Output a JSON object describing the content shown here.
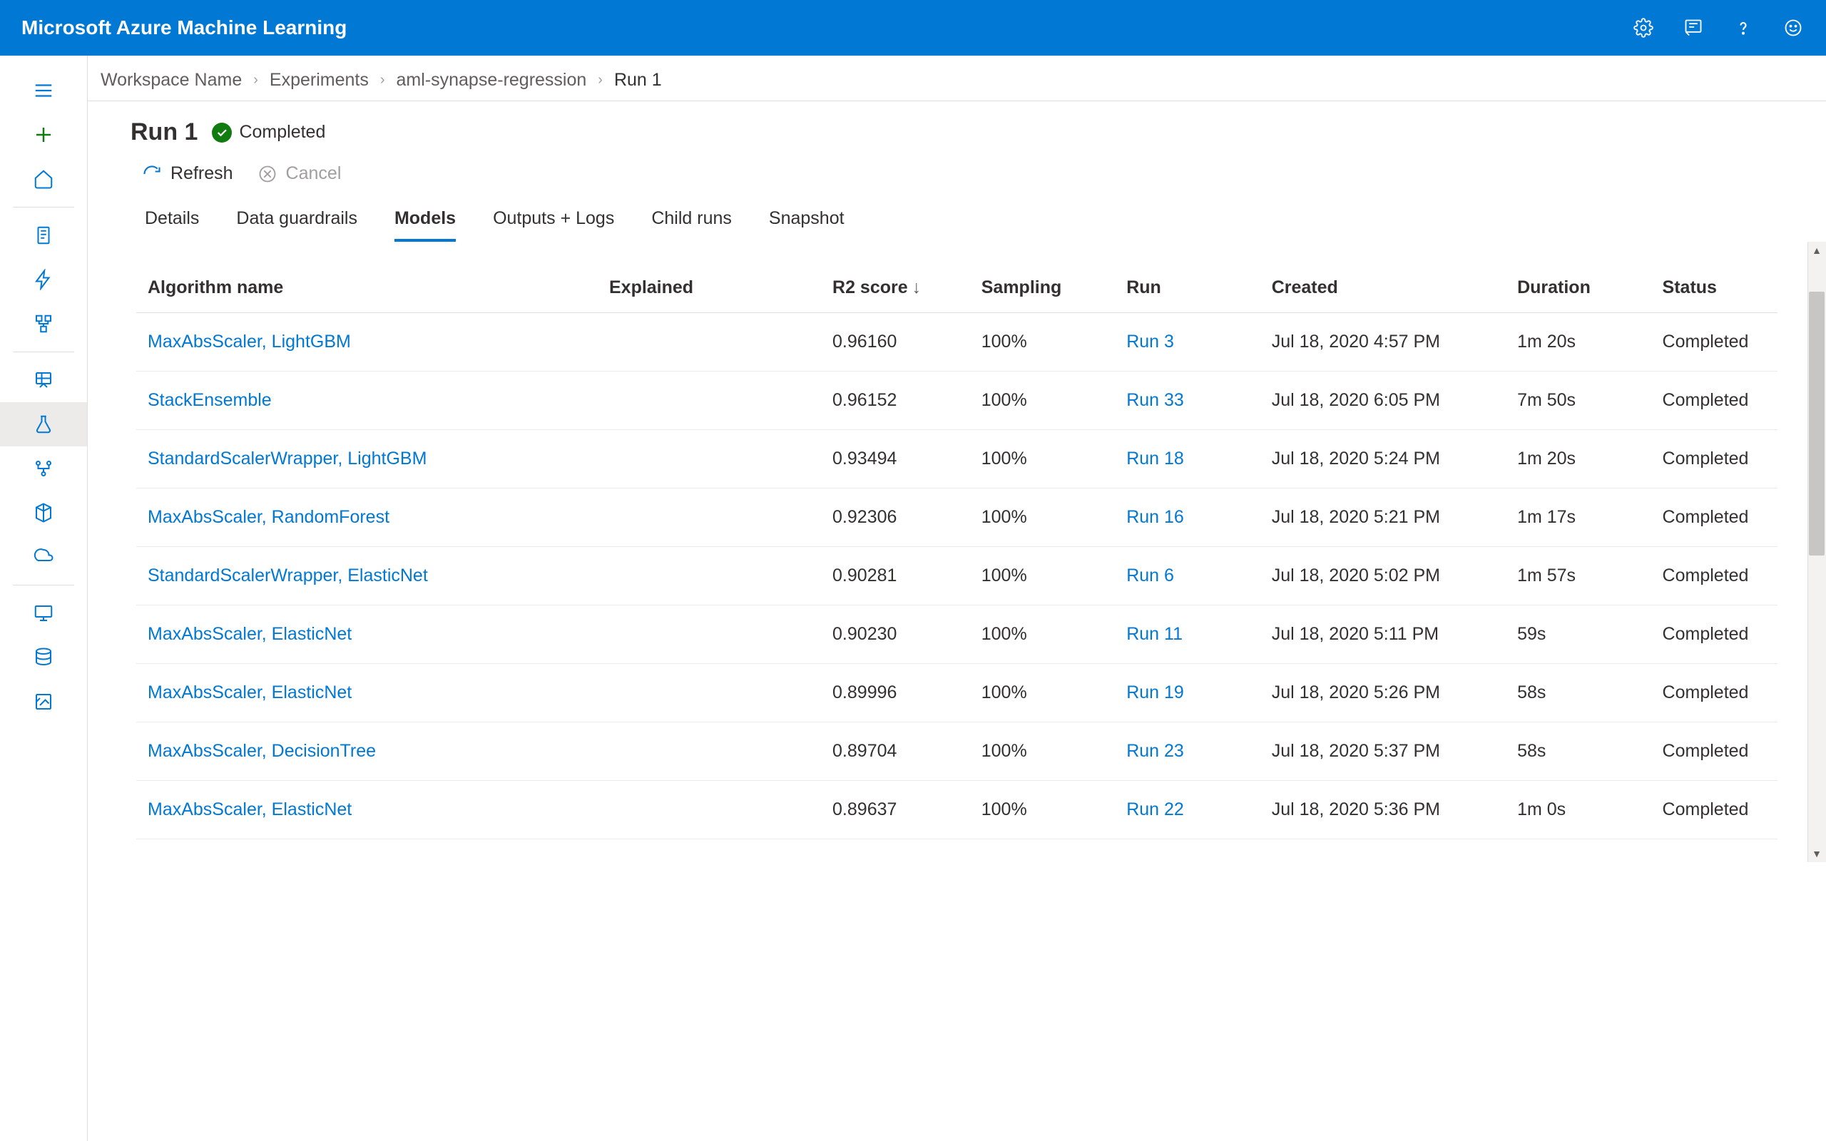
{
  "app_title": "Microsoft Azure Machine Learning",
  "breadcrumb": {
    "workspace": "Workspace Name",
    "experiments": "Experiments",
    "experiment_name": "aml-synapse-regression",
    "current": "Run 1"
  },
  "run": {
    "title": "Run 1",
    "status": "Completed"
  },
  "toolbar": {
    "refresh": "Refresh",
    "cancel": "Cancel"
  },
  "tabs": {
    "details": "Details",
    "data_guardrails": "Data guardrails",
    "models": "Models",
    "outputs_logs": "Outputs + Logs",
    "child_runs": "Child runs",
    "snapshot": "Snapshot"
  },
  "columns": {
    "algorithm": "Algorithm name",
    "explained": "Explained",
    "r2": "R2 score",
    "sampling": "Sampling",
    "run": "Run",
    "created": "Created",
    "duration": "Duration",
    "status": "Status"
  },
  "rows": [
    {
      "algorithm": "MaxAbsScaler, LightGBM",
      "explained": "",
      "r2": "0.96160",
      "sampling": "100%",
      "run": "Run 3",
      "created": "Jul 18, 2020 4:57 PM",
      "duration": "1m 20s",
      "status": "Completed"
    },
    {
      "algorithm": "StackEnsemble",
      "explained": "",
      "r2": "0.96152",
      "sampling": "100%",
      "run": "Run 33",
      "created": "Jul 18, 2020 6:05 PM",
      "duration": "7m 50s",
      "status": "Completed"
    },
    {
      "algorithm": "StandardScalerWrapper, LightGBM",
      "explained": "",
      "r2": "0.93494",
      "sampling": "100%",
      "run": "Run 18",
      "created": "Jul 18, 2020 5:24 PM",
      "duration": "1m 20s",
      "status": "Completed"
    },
    {
      "algorithm": "MaxAbsScaler, RandomForest",
      "explained": "",
      "r2": "0.92306",
      "sampling": "100%",
      "run": "Run 16",
      "created": "Jul 18, 2020 5:21 PM",
      "duration": "1m 17s",
      "status": "Completed"
    },
    {
      "algorithm": "StandardScalerWrapper, ElasticNet",
      "explained": "",
      "r2": "0.90281",
      "sampling": "100%",
      "run": "Run 6",
      "created": "Jul 18, 2020 5:02 PM",
      "duration": "1m 57s",
      "status": "Completed"
    },
    {
      "algorithm": "MaxAbsScaler, ElasticNet",
      "explained": "",
      "r2": "0.90230",
      "sampling": "100%",
      "run": "Run 11",
      "created": "Jul 18, 2020 5:11 PM",
      "duration": "59s",
      "status": "Completed"
    },
    {
      "algorithm": "MaxAbsScaler, ElasticNet",
      "explained": "",
      "r2": "0.89996",
      "sampling": "100%",
      "run": "Run 19",
      "created": "Jul 18, 2020 5:26 PM",
      "duration": "58s",
      "status": "Completed"
    },
    {
      "algorithm": "MaxAbsScaler, DecisionTree",
      "explained": "",
      "r2": "0.89704",
      "sampling": "100%",
      "run": "Run 23",
      "created": "Jul 18, 2020 5:37 PM",
      "duration": "58s",
      "status": "Completed"
    },
    {
      "algorithm": "MaxAbsScaler, ElasticNet",
      "explained": "",
      "r2": "0.89637",
      "sampling": "100%",
      "run": "Run 22",
      "created": "Jul 18, 2020 5:36 PM",
      "duration": "1m 0s",
      "status": "Completed"
    }
  ]
}
